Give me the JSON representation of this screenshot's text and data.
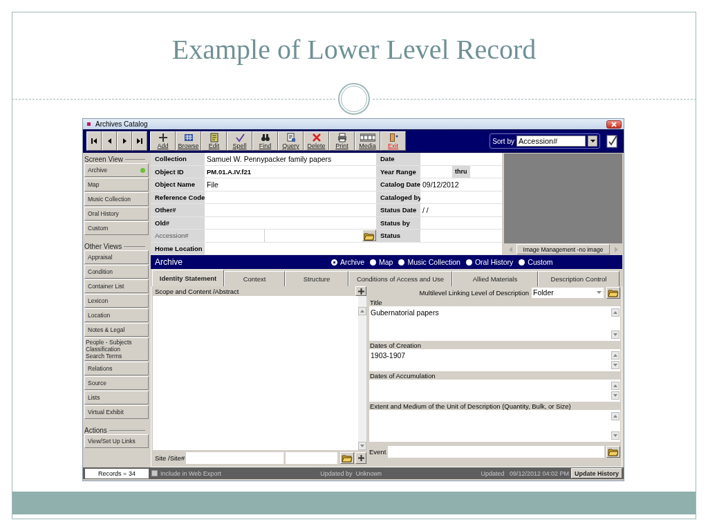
{
  "slide": {
    "title": "Example of Lower Level Record"
  },
  "window": {
    "title": "Archives Catalog"
  },
  "toolbar": {
    "tools": [
      {
        "label": "Add",
        "kind": "add"
      },
      {
        "label": "Browse",
        "kind": "browse"
      },
      {
        "label": "Edit",
        "kind": "edit"
      },
      {
        "label": "Spell",
        "kind": "spell"
      },
      {
        "label": "Find",
        "kind": "find"
      },
      {
        "label": "Query",
        "kind": "query"
      },
      {
        "label": "Delete",
        "kind": "delete"
      },
      {
        "label": "Print",
        "kind": "print"
      },
      {
        "label": "Media",
        "kind": "media"
      },
      {
        "label": "Exit",
        "kind": "exit"
      }
    ],
    "sort": {
      "label": "Sort by",
      "value": "Accession#"
    }
  },
  "sidebar": {
    "sections": [
      {
        "heading": "Screen View",
        "items": [
          {
            "label": "Archive",
            "selected": true
          },
          {
            "label": "Map",
            "selected": false
          },
          {
            "label": "Music Collection",
            "selected": false
          },
          {
            "label": "Oral History",
            "selected": false
          },
          {
            "label": "Custom",
            "selected": false
          }
        ]
      },
      {
        "heading": "Other Views",
        "items": [
          {
            "label": "Appraisal"
          },
          {
            "label": "Condition"
          },
          {
            "label": "Container List"
          },
          {
            "label": "Lexicon"
          },
          {
            "label": "Location"
          },
          {
            "label": "Notes & Legal"
          },
          {
            "label": "People - Subjects\nClassification\nSearch Terms"
          },
          {
            "label": "Relations"
          },
          {
            "label": "Source"
          },
          {
            "label": "Lists"
          },
          {
            "label": "Virtual Exhibit"
          }
        ]
      },
      {
        "heading": "Actions",
        "items": [
          {
            "label": "View/Set Up Links"
          }
        ]
      }
    ],
    "records": "Records = 34"
  },
  "record_fields": {
    "left": [
      {
        "label": "Collection",
        "value": "Samuel W. Pennypacker family papers",
        "kind": "text",
        "disabled": false
      },
      {
        "label": "Object ID",
        "value": "PM.01.A.IV.f21",
        "kind": "id",
        "disabled": false
      },
      {
        "label": "Object Name",
        "value": "File",
        "kind": "text",
        "disabled": false
      },
      {
        "label": "Reference Code",
        "kind": "text",
        "disabled": false
      },
      {
        "label": "Other#",
        "kind": "text",
        "disabled": false
      },
      {
        "label": "Old#",
        "kind": "text",
        "disabled": false
      },
      {
        "label": "Accession#",
        "kind": "split",
        "disabled": true
      },
      {
        "label": "Home Location",
        "kind": "text",
        "disabled": false
      }
    ],
    "right": [
      {
        "label": "Date",
        "kind": "text"
      },
      {
        "label": "Year Range",
        "kind": "range",
        "middle": "thru"
      },
      {
        "label": "Catalog Date",
        "value": "09/12/2012",
        "kind": "text"
      },
      {
        "label": "Cataloged by",
        "kind": "text"
      },
      {
        "label": "Status Date",
        "value": "/ /",
        "kind": "text"
      },
      {
        "label": "Status by",
        "kind": "text"
      },
      {
        "label": "Status",
        "kind": "text"
      }
    ]
  },
  "image_panel": {
    "caption": "Image Management -no image"
  },
  "view_bar": {
    "title": "Archive",
    "options": [
      {
        "label": "Archive",
        "selected": true
      },
      {
        "label": "Map",
        "selected": false
      },
      {
        "label": "Music Collection",
        "selected": false
      },
      {
        "label": "Oral History",
        "selected": false
      },
      {
        "label": "Custom",
        "selected": false
      }
    ]
  },
  "tabs": [
    {
      "label": "Identity Statement",
      "selected": true
    },
    {
      "label": "Context",
      "selected": false
    },
    {
      "label": "Structure",
      "selected": false
    },
    {
      "label": "Conditions of Access and Use",
      "selected": false
    },
    {
      "label": "Allied Materials",
      "selected": false
    },
    {
      "label": "Description Control",
      "selected": false
    }
  ],
  "left_pane": {
    "label": "Scope and Content /Abstract",
    "site_label": "Site /Site#"
  },
  "right_pane": {
    "level_label": "Multilevel Linking Level of Description",
    "level_value": "Folder",
    "fields": [
      {
        "label": "Title",
        "value": "Gubernatorial papers"
      },
      {
        "label": "Dates of Creation",
        "value": "1903-1907"
      },
      {
        "label": "Dates of Accumulation"
      },
      {
        "label": "Extent and Medium of the Unit of Description (Quantity, Bulk, or Size)"
      }
    ],
    "event_label": "Event"
  },
  "status_bar": {
    "web_export": {
      "label": "Include in Web Export",
      "checked": false
    },
    "updated_by_label": "Updated by",
    "updated_by": "Unknown",
    "updated_label": "Updated",
    "updated": "09/12/2012 04:02 PM",
    "history_button": "Update History"
  }
}
